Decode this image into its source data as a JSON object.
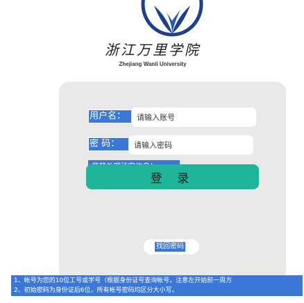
{
  "header": {
    "school_name_cn": "浙江万里学院",
    "school_name_en": "Zhejiang Wanli University"
  },
  "login": {
    "username_label": "用户名：",
    "username_placeholder": "请输入账号",
    "password_label": "密 码：",
    "password_placeholder": "请输入密码",
    "warning": "严禁处理涉密信息！",
    "login_button": "登 录",
    "forgot_password": "找回密码"
  },
  "notice": {
    "lines": [
      "1、帐号为您的10位工号或学号（根据身份证号查询帐号，注意左开始前一周方",
      "2、初始密码为身份证后6位，所有帐号密码均区分大小写。"
    ]
  },
  "colors": {
    "label_blue": "#3b78d6",
    "button_green": "#1fb59a",
    "card_gray": "#e9e9e9"
  },
  "icons": {
    "logo": "university-emblem-icon"
  }
}
